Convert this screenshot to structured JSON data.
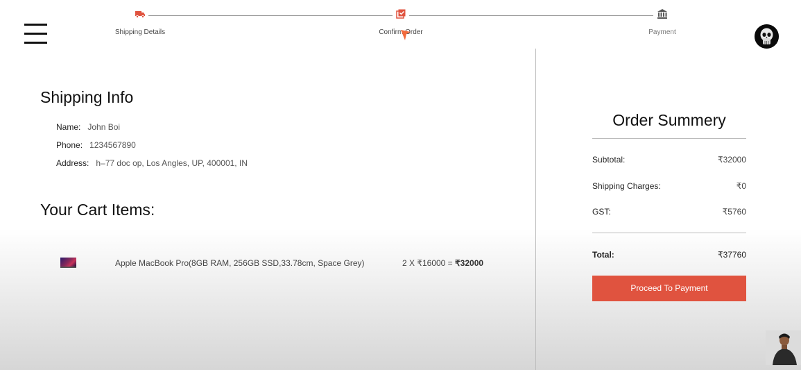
{
  "stepper": {
    "steps": [
      {
        "label": "Shipping Details",
        "icon": "truck-icon",
        "active": true
      },
      {
        "label": "Confirm Order",
        "icon": "checklist-icon",
        "active": true
      },
      {
        "label": "Payment",
        "icon": "bank-icon",
        "active": false
      }
    ],
    "active_color": "#e0533f"
  },
  "shipping_info": {
    "title": "Shipping Info",
    "name_label": "Name:",
    "name_value": "John Boi",
    "phone_label": "Phone:",
    "phone_value": "1234567890",
    "address_label": "Address:",
    "address_value": "h–77 doc op, Los Angles, UP, 400001, IN"
  },
  "cart": {
    "title": "Your Cart Items:",
    "items": [
      {
        "name": "Apple MacBook Pro(8GB RAM, 256GB SSD,33.78cm, Space Grey)",
        "quantity_expr": "2 X ₹16000 = ",
        "total": "₹32000"
      }
    ]
  },
  "summary": {
    "title": "Order Summery",
    "subtotal_label": "Subtotal:",
    "subtotal_value": "₹32000",
    "shipping_label": "Shipping Charges:",
    "shipping_value": "₹0",
    "gst_label": "GST:",
    "gst_value": "₹5760",
    "total_label": "Total:",
    "total_value": "₹37760",
    "button_label": "Proceed To Payment",
    "button_color": "#e0533f"
  }
}
